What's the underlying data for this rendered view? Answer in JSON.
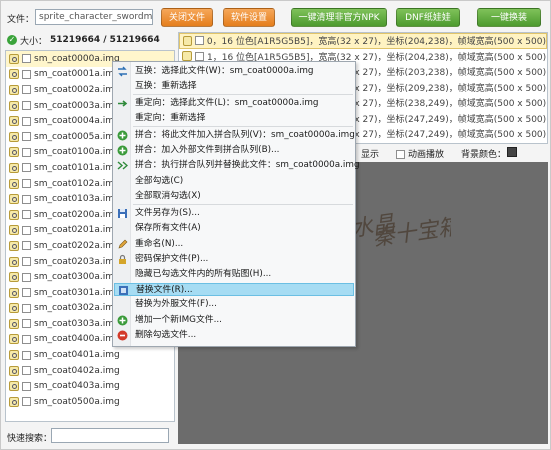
{
  "toolbar": {
    "file_label": "文件：",
    "file_value": "sprite_character_swordma",
    "buttons": [
      {
        "label": "关闭文件",
        "color": "orange"
      },
      {
        "label": "软件设置",
        "color": "orange"
      },
      {
        "label": "一键清理非官方NPK",
        "color": "green"
      },
      {
        "label": "DNF纸娃娃",
        "color": "green"
      },
      {
        "label": "一键换装",
        "color": "green"
      }
    ]
  },
  "size": {
    "label": "大小：",
    "value": "51219664 / 51219664"
  },
  "file_list": [
    "sm_coat0000a.img",
    "sm_coat0001a.img",
    "sm_coat0002a.img",
    "sm_coat0003a.img",
    "sm_coat0004a.img",
    "sm_coat0005a.img",
    "sm_coat0100a.img",
    "sm_coat0101a.img",
    "sm_coat0102a.img",
    "sm_coat0103a.img",
    "sm_coat0200a.img",
    "sm_coat0201a.img",
    "sm_coat0202a.img",
    "sm_coat0203a.img",
    "sm_coat0300a.img",
    "sm_coat0301a.img",
    "sm_coat0302a.img",
    "sm_coat0303a.img",
    "sm_coat0400a.img",
    "sm_coat0401a.img",
    "sm_coat0402a.img",
    "sm_coat0403a.img",
    "sm_coat0500a.img"
  ],
  "info_list": [
    "0，16 位色[A1R5G5B5]，宽高(32 x 27)，坐标(204,238)，帧域宽高(500 x 500)",
    "1，16 位色[A1R5G5B5]，宽高(32 x 27)，坐标(204,238)，帧域宽高(500 x 500)",
    "2，16 位色[A1R5G5B5]，宽高(33 x 27)，坐标(203,238)，帧域宽高(500 x 500)",
    "3，16 位色[A1R5G5B5]，宽高(33 x 27)，坐标(209,238)，帧域宽高(500 x 500)",
    "4，16 位色[A1R5G5B5]，宽高(33 x 27)，坐标(238,249)，帧域宽高(500 x 500)",
    "5，16 位色[A1R5G5B5]，宽高(33 x 27)，坐标(247,249)，帧域宽高(500 x 500)",
    "6，16 位色[A1R5G5B5]，宽高(33 x 27)，坐标(247,249)，帧域宽高(500 x 500)"
  ],
  "view_bar": {
    "show_label": "显示",
    "anim_label": "动画播放",
    "bg_label": "背景颜色：",
    "bg_color": "#444444"
  },
  "search": {
    "label": "快速搜索："
  },
  "context_menu": [
    {
      "label": "互换：选择此文件(W)：sm_coat0000a.img",
      "icon": "swap-icon",
      "highlight": false
    },
    {
      "label": "互换：重新选择",
      "icon": "",
      "highlight": false
    },
    {
      "label": "重定向：选择此文件(L)：sm_coat0000a.img",
      "icon": "redirect-icon",
      "highlight": false
    },
    {
      "label": "重定向：重新选择",
      "icon": "",
      "highlight": false
    },
    {
      "label": "拼合：将此文件加入拼合队列(V)：sm_coat0000a.img",
      "icon": "add-icon",
      "highlight": false
    },
    {
      "label": "拼合：加入外部文件到拼合队列(B)...",
      "icon": "add-icon",
      "highlight": false
    },
    {
      "label": "拼合：执行拼合队列并替换此文件：sm_coat0000a.img",
      "icon": "merge-icon",
      "highlight": false
    },
    {
      "label": "全部勾选(C)",
      "icon": "",
      "highlight": false
    },
    {
      "label": "全部取消勾选(X)",
      "icon": "",
      "highlight": false
    },
    {
      "label": "文件另存为(S)...",
      "icon": "save-icon",
      "highlight": false
    },
    {
      "label": "保存所有文件(A)",
      "icon": "",
      "highlight": false
    },
    {
      "label": "重命名(N)...",
      "icon": "rename-icon",
      "highlight": false
    },
    {
      "label": "密码保护文件(P)...",
      "icon": "lock-icon",
      "highlight": false
    },
    {
      "label": "隐藏已勾选文件内的所有贴图(H)...",
      "icon": "",
      "highlight": false
    },
    {
      "label": "替换文件(R)...",
      "icon": "replace-icon",
      "highlight": true
    },
    {
      "label": "替换为外服文件(F)...",
      "icon": "",
      "highlight": false
    },
    {
      "label": "增加一个新IMG文件...",
      "icon": "plus-icon",
      "highlight": false
    },
    {
      "label": "删除勾选文件...",
      "icon": "delete-icon",
      "highlight": false
    }
  ],
  "watermark": "玩起水晶秦十宝箱"
}
